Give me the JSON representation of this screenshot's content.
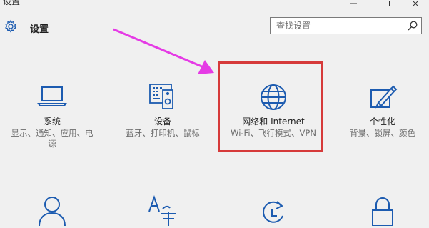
{
  "window": {
    "title": "设置"
  },
  "header": {
    "title": "设置",
    "icon": "gear-icon"
  },
  "search": {
    "placeholder": "查找设置",
    "icon": "search-icon"
  },
  "tiles": [
    {
      "title": "系统",
      "desc": "显示、通知、应用、电源",
      "icon": "laptop-icon"
    },
    {
      "title": "设备",
      "desc": "蓝牙、打印机、鼠标",
      "icon": "devices-icon"
    },
    {
      "title": "网络和 Internet",
      "desc": "Wi-Fi、飞行模式、VPN",
      "icon": "globe-icon"
    },
    {
      "title": "个性化",
      "desc": "背景、锁屏、颜色",
      "icon": "personalization-icon"
    }
  ],
  "second_row_icons": [
    "accounts-icon",
    "time-language-icon",
    "update-icon",
    "privacy-icon"
  ],
  "colors": {
    "accent": "#1c5bb0",
    "highlight": "#d63a3a",
    "arrow": "#e53be5"
  }
}
